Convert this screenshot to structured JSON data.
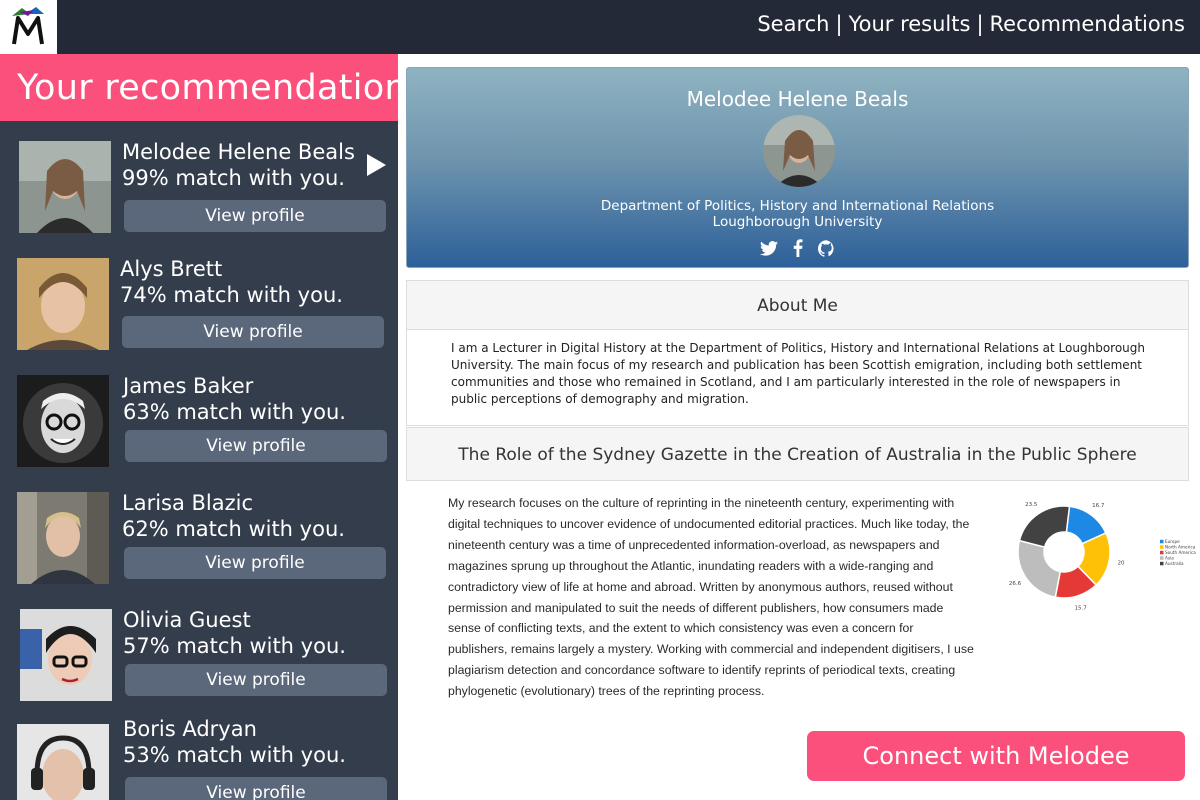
{
  "nav": {
    "search": "Search",
    "sep1": "|",
    "results": "Your results",
    "sep2": "|",
    "recommendations": "Recommendations"
  },
  "sidebar": {
    "title": "Your recommendations",
    "people": [
      {
        "name": "Melodee Helene Beals",
        "match": "99% match with you.",
        "button": "View profile"
      },
      {
        "name": "Alys Brett",
        "match": "74% match with you.",
        "button": "View profile"
      },
      {
        "name": "James Baker",
        "match": "63% match with you.",
        "button": "View profile"
      },
      {
        "name": "Larisa Blazic",
        "match": "62% match with you.",
        "button": "View profile"
      },
      {
        "name": "Olivia Guest",
        "match": "57% match with you.",
        "button": "View profile"
      },
      {
        "name": "Boris Adryan",
        "match": "53% match with you.",
        "button": "View profile"
      }
    ]
  },
  "profile": {
    "name": "Melodee Helene Beals",
    "department": "Department of Politics, History and International Relations",
    "university": "Loughborough University",
    "icons": [
      "twitter-icon",
      "facebook-icon",
      "github-icon"
    ]
  },
  "about": {
    "heading": "About Me",
    "text": "I am a Lecturer in Digital History at the Department of Politics, History and International Relations at Loughborough University. The main focus of my research and publication has been Scottish emigration, including both settlement communities and those who remained in Scotland, and I am particularly interested in the role of newspapers in public perceptions of demography and migration."
  },
  "project": {
    "heading": "The Role of the Sydney Gazette in the Creation of Australia in the Public Sphere",
    "text": "My research focuses on the culture of reprinting in the nineteenth century, experimenting with digital techniques to uncover evidence of undocumented editorial practices. Much like today, the nineteenth century was a time of unprecedented information-overload, as newspapers and magazines sprung up throughout the Atlantic, inundating readers with a wide-ranging and contradictory view of life at home and abroad. Written by anonymous authors, reused without permission and manipulated to suit the needs of different publishers, how consumers made sense of conflicting texts, and the extent to which consistency was even a concern for publishers, remains largely a mystery. Working with commercial and independent digitisers, I use plagiarism detection and concordance software to identify reprints of periodical texts, creating phylogenetic (evolutionary) trees of the reprinting process."
  },
  "chart": {
    "type": "pie",
    "slices": [
      {
        "label": "Europe",
        "value": 16.7,
        "color": "#1e88e5"
      },
      {
        "label": "North America",
        "value": 20,
        "color": "#ffc107"
      },
      {
        "label": "South America",
        "value": 15.7,
        "color": "#e53935"
      },
      {
        "label": "Asia",
        "value": 26.6,
        "color": "#bdbdbd"
      },
      {
        "label": "Australia",
        "value": 23.5,
        "color": "#424242"
      }
    ],
    "value_labels": [
      "16.7",
      "20",
      "15.7",
      "26.6",
      "23.5"
    ]
  },
  "connect_button": "Connect with Melodee"
}
